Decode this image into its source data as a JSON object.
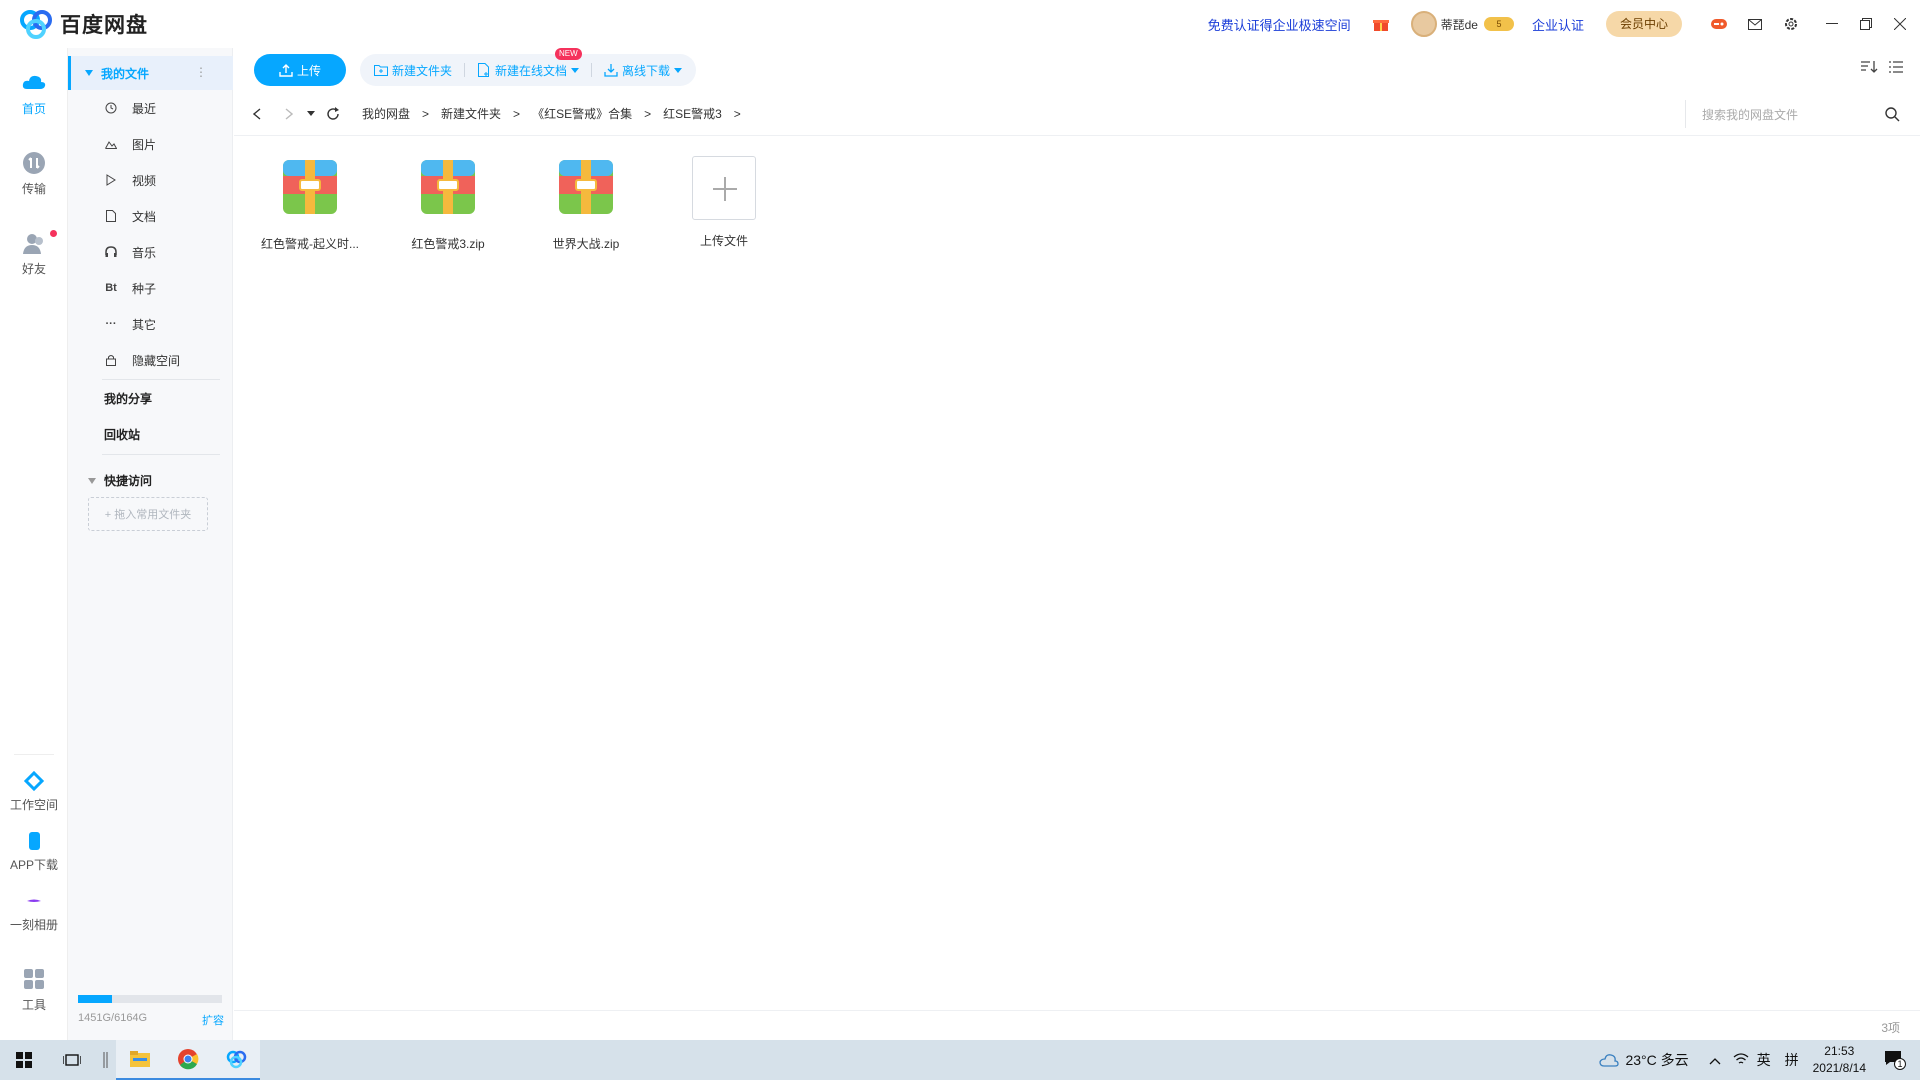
{
  "app": {
    "title": "百度网盘"
  },
  "titlebar": {
    "promo": "免费认证得企业极速空间",
    "username": "蒂琵de",
    "vip_level": "5",
    "enterprise": "企业认证",
    "member_center": "会员中心"
  },
  "rail": {
    "home": "首页",
    "transfer": "传输",
    "friends": "好友",
    "workspace": "工作空间",
    "app_download": "APP下载",
    "album": "一刻相册",
    "tools": "工具"
  },
  "sidebar": {
    "my_files": "我的文件",
    "items": [
      {
        "label": "最近",
        "icon": "clock-icon"
      },
      {
        "label": "图片",
        "icon": "image-icon"
      },
      {
        "label": "视频",
        "icon": "play-icon"
      },
      {
        "label": "文档",
        "icon": "document-icon"
      },
      {
        "label": "音乐",
        "icon": "headphones-icon"
      },
      {
        "label": "种子",
        "icon": "bt-icon",
        "glyph": "Bt"
      },
      {
        "label": "其它",
        "icon": "more-icon",
        "glyph": "···"
      },
      {
        "label": "隐藏空间",
        "icon": "lock-icon"
      }
    ],
    "my_share": "我的分享",
    "recycle": "回收站",
    "quick_access": "快捷访问",
    "drop_hint": "+ 拖入常用文件夹",
    "quota": "1451G/6164G",
    "quota_fraction": 0.235,
    "expand": "扩容"
  },
  "toolbar": {
    "upload": "上传",
    "new_folder": "新建文件夹",
    "new_doc": "新建在线文档",
    "new_tag": "NEW",
    "offline": "离线下载"
  },
  "breadcrumb": [
    "我的网盘",
    "新建文件夹",
    "《红SE警戒》合集",
    "红SE警戒3"
  ],
  "search": {
    "placeholder": "搜索我的网盘文件"
  },
  "files": [
    {
      "name": "红色警戒-起义时..."
    },
    {
      "name": "红色警戒3.zip"
    },
    {
      "name": "世界大战.zip"
    }
  ],
  "upload_tile": "上传文件",
  "status": {
    "count": "3项"
  },
  "taskbar": {
    "weather": "23°C 多云",
    "ime": "英",
    "ime2": "拼",
    "time": "21:53",
    "date": "2021/8/14",
    "notif": "1"
  }
}
